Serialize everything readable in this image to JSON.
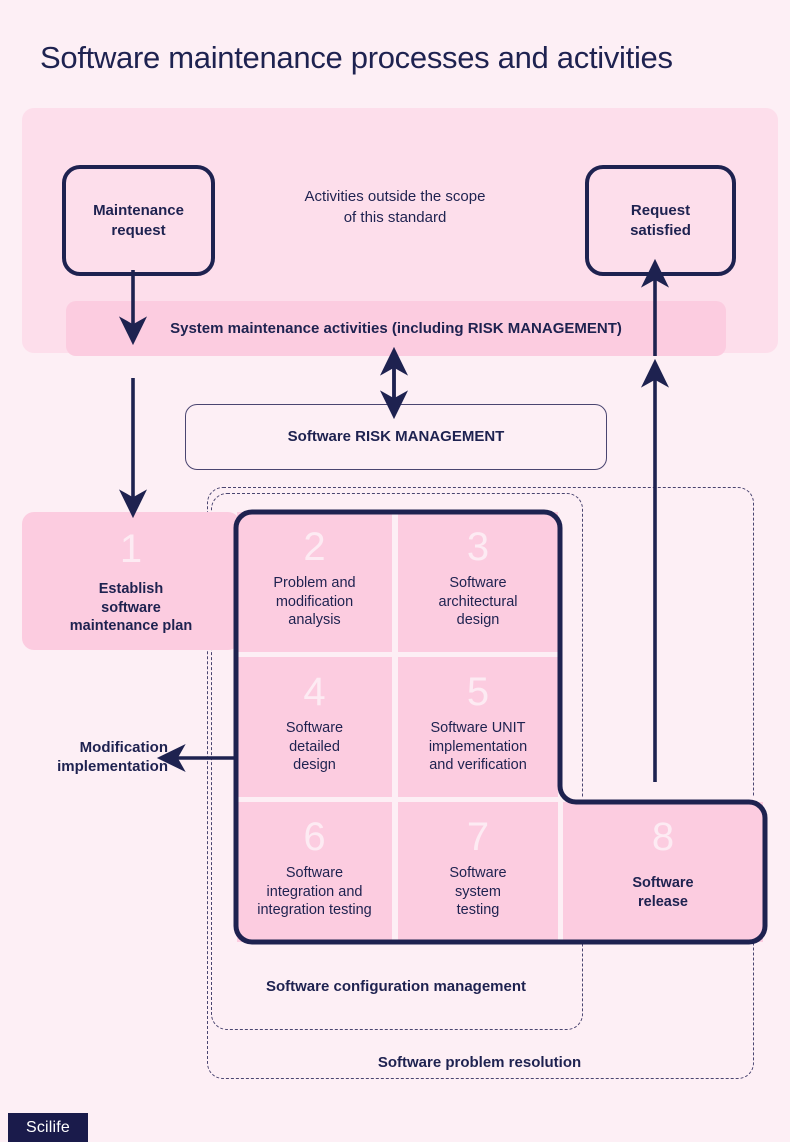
{
  "page": {
    "title": "Software maintenance processes and activities",
    "background_color": "#FDEFF5",
    "ink_color": "#1E2250",
    "pink_mid": "#FCCCE0",
    "pink_light": "#FDDEEB"
  },
  "top_section": {
    "scope_note": "Activities outside the scope\nof this standard",
    "scope_note_line1": "Activities outside the scope",
    "scope_note_line2": "of this standard",
    "maintenance_request": "Maintenance\nrequest",
    "maintenance_request_line1": "Maintenance",
    "maintenance_request_line2": "request",
    "request_satisfied": "Request\nsatisfied",
    "request_satisfied_line1": "Request",
    "request_satisfied_line2": "satisfied",
    "system_maintenance_bar": "System maintenance activities (including RISK MANAGEMENT)"
  },
  "risk_management": {
    "label": "Software RISK MANAGEMENT"
  },
  "containers": {
    "configuration_management": "Software configuration management",
    "problem_resolution": "Software problem resolution"
  },
  "side_labels": {
    "modification_implementation_line1": "Modification",
    "modification_implementation_line2": "implementation"
  },
  "steps": [
    {
      "number": "1",
      "lines": [
        "Establish",
        "software",
        "maintenance plan"
      ],
      "bold": true
    },
    {
      "number": "2",
      "lines": [
        "Problem and",
        "modification",
        "analysis"
      ],
      "bold": false
    },
    {
      "number": "3",
      "lines": [
        "Software",
        "architectural",
        "design"
      ],
      "bold": false
    },
    {
      "number": "4",
      "lines": [
        "Software",
        "detailed",
        "design"
      ],
      "bold": false
    },
    {
      "number": "5",
      "lines": [
        "Software UNIT",
        "implementation",
        "and verification"
      ],
      "bold": false
    },
    {
      "number": "6",
      "lines": [
        "Software",
        "integration and",
        "integration testing"
      ],
      "bold": false
    },
    {
      "number": "7",
      "lines": [
        "Software",
        "system",
        "testing"
      ],
      "bold": false
    },
    {
      "number": "8",
      "lines": [
        "Software",
        "release"
      ],
      "bold": true
    }
  ],
  "footer": {
    "logo_text": "Scilife",
    "logo_background": "#1A1B4B"
  }
}
